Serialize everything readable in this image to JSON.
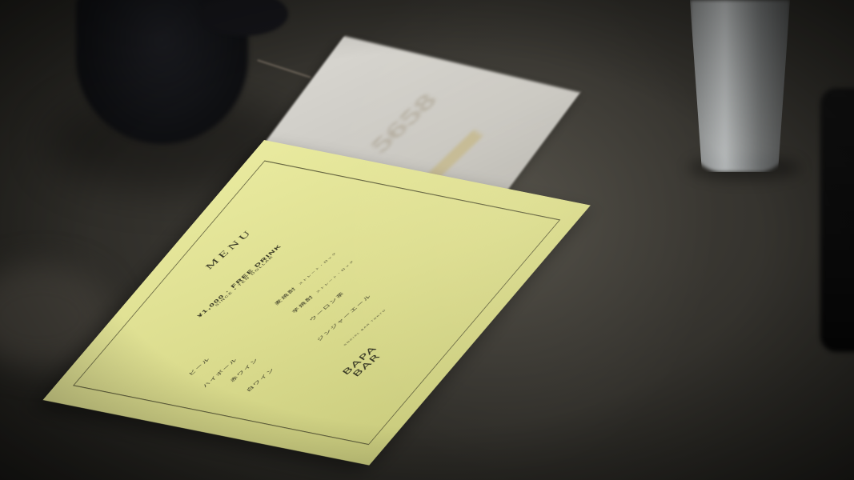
{
  "scene": {
    "colors": {
      "table": "#3a3833",
      "menu_card": "#e2e394",
      "menu_ink": "#2f2f1f",
      "background_card": "#d2d0ca",
      "cup": "#d9dde0"
    }
  },
  "background_card": {
    "number": "5658"
  },
  "menu": {
    "title": "MENU",
    "free_drink": "¥1,000 · FREE DRINK",
    "free_drink_note": "SINCE ▪ TEN DOLLAR",
    "items": [
      {
        "label": "ビール"
      },
      {
        "label": "ハイボール"
      },
      {
        "label": "赤ワイン"
      },
      {
        "label": "白ワイン"
      },
      {
        "label": "麦焼酎",
        "note": "ストレート・ロック"
      },
      {
        "label": "芋焼酎",
        "note": "ストレート・ロック"
      },
      {
        "label": "ウーロン茶"
      },
      {
        "label": "ジンジャーエール"
      }
    ],
    "logo_line1": "BAPA",
    "logo_line2": "BAR",
    "logo_sub": "SOCIAL BAR TOKYO"
  }
}
